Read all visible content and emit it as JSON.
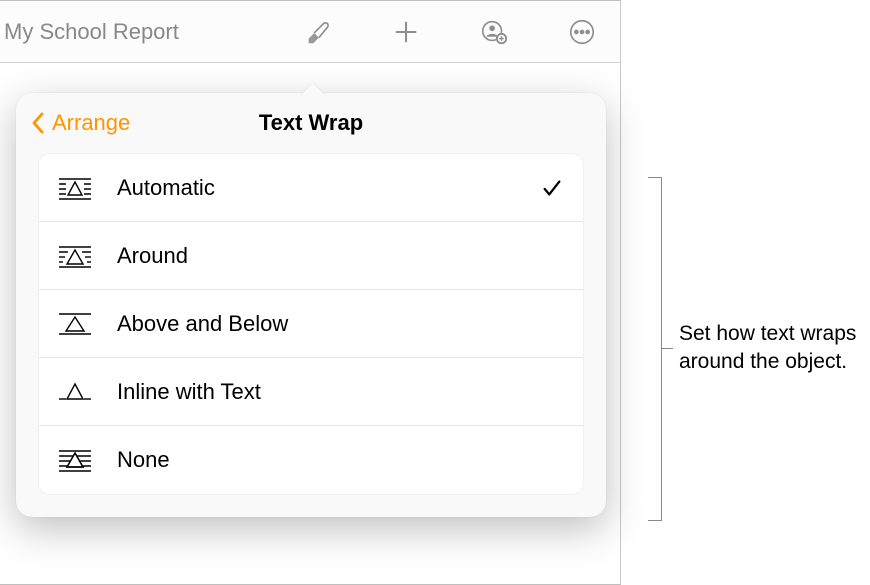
{
  "toolbar": {
    "doc_title": "My School Report"
  },
  "popover": {
    "back_label": "Arrange",
    "title": "Text Wrap",
    "options": [
      {
        "label": "Automatic",
        "selected": true
      },
      {
        "label": "Around",
        "selected": false
      },
      {
        "label": "Above and Below",
        "selected": false
      },
      {
        "label": "Inline with Text",
        "selected": false
      },
      {
        "label": "None",
        "selected": false
      }
    ]
  },
  "annotation": {
    "text": "Set how text wraps around the object."
  }
}
